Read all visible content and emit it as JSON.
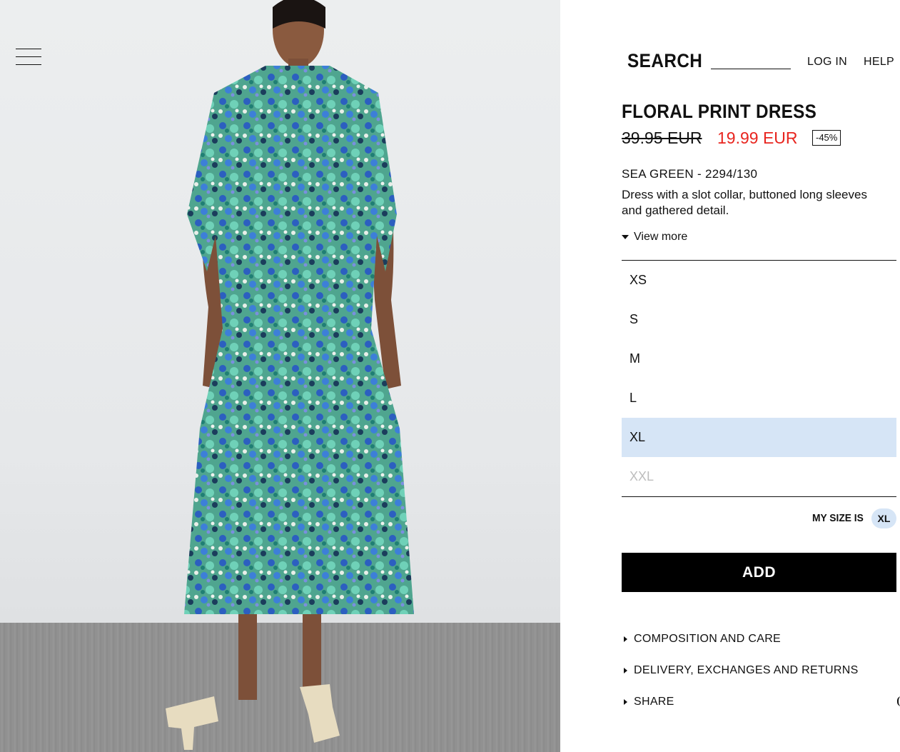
{
  "header": {
    "search_label": "SEARCH",
    "login_label": "LOG IN",
    "help_label": "HELP",
    "menu_icon": "hamburger-menu-icon"
  },
  "product": {
    "title": "FLORAL PRINT DRESS",
    "old_price": "39.95 EUR",
    "new_price": "19.99 EUR",
    "discount": "-45%",
    "color_ref": "SEA GREEN - 2294/130",
    "description": "Dress with a slot collar, buttoned long sleeves and gathered detail.",
    "view_more": "View more",
    "image": "model-wearing-floral-dress"
  },
  "sizes": [
    {
      "label": "XS",
      "state": "available"
    },
    {
      "label": "S",
      "state": "available"
    },
    {
      "label": "M",
      "state": "available"
    },
    {
      "label": "L",
      "state": "available"
    },
    {
      "label": "XL",
      "state": "selected"
    },
    {
      "label": "XXL",
      "state": "disabled"
    }
  ],
  "my_size": {
    "label": "MY SIZE IS",
    "value": "XL"
  },
  "add_button": "ADD",
  "accordions": [
    "COMPOSITION AND CARE",
    "DELIVERY, EXCHANGES AND RETURNS",
    "SHARE"
  ],
  "colors": {
    "sale_red": "#e8251f",
    "selected_size_bg": "#d6e5f6",
    "button_black": "#000000"
  }
}
